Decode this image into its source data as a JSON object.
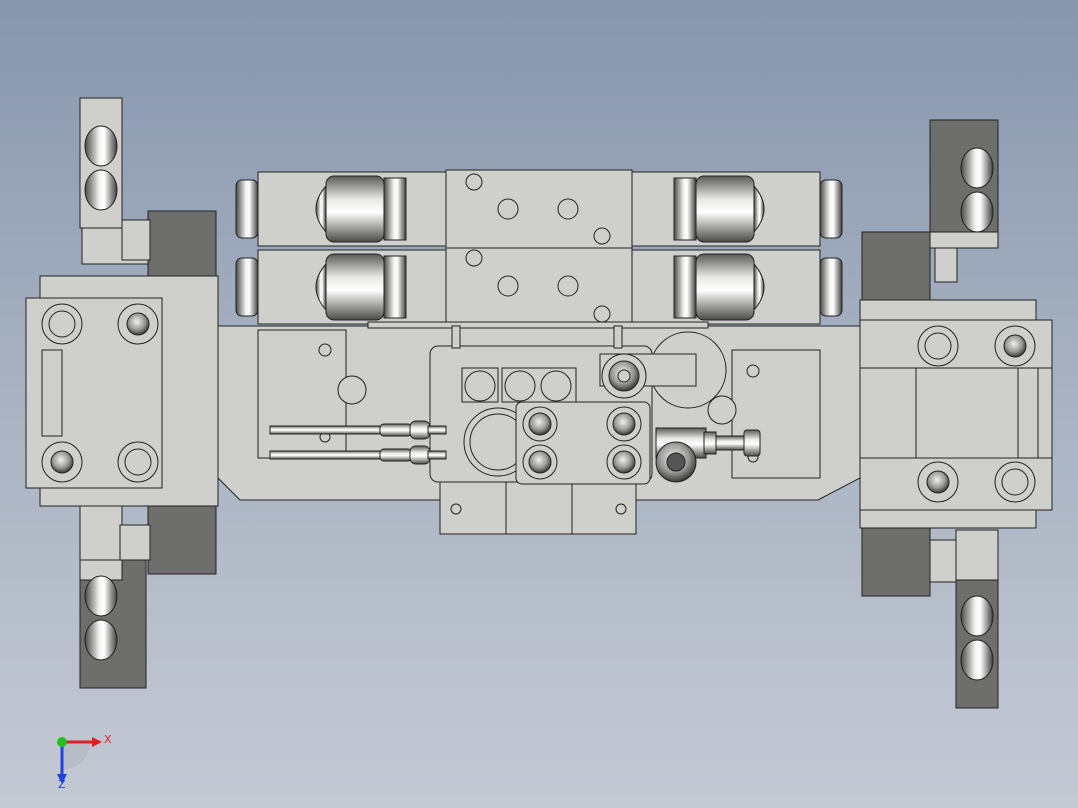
{
  "viewport": {
    "background_top": "#8796ad",
    "background_bottom": "#c4cad4"
  },
  "model": {
    "part_fill": "#cfd0cc",
    "part_stroke": "#222222",
    "dark_fill": "#6e6e6c",
    "steel_light": "#f0f0f0",
    "steel_dark": "#555555"
  },
  "triad": {
    "x_label": "X",
    "z_label": "Z",
    "x_color": "#e02020",
    "y_color": "#20c020",
    "z_color": "#2040e0"
  }
}
